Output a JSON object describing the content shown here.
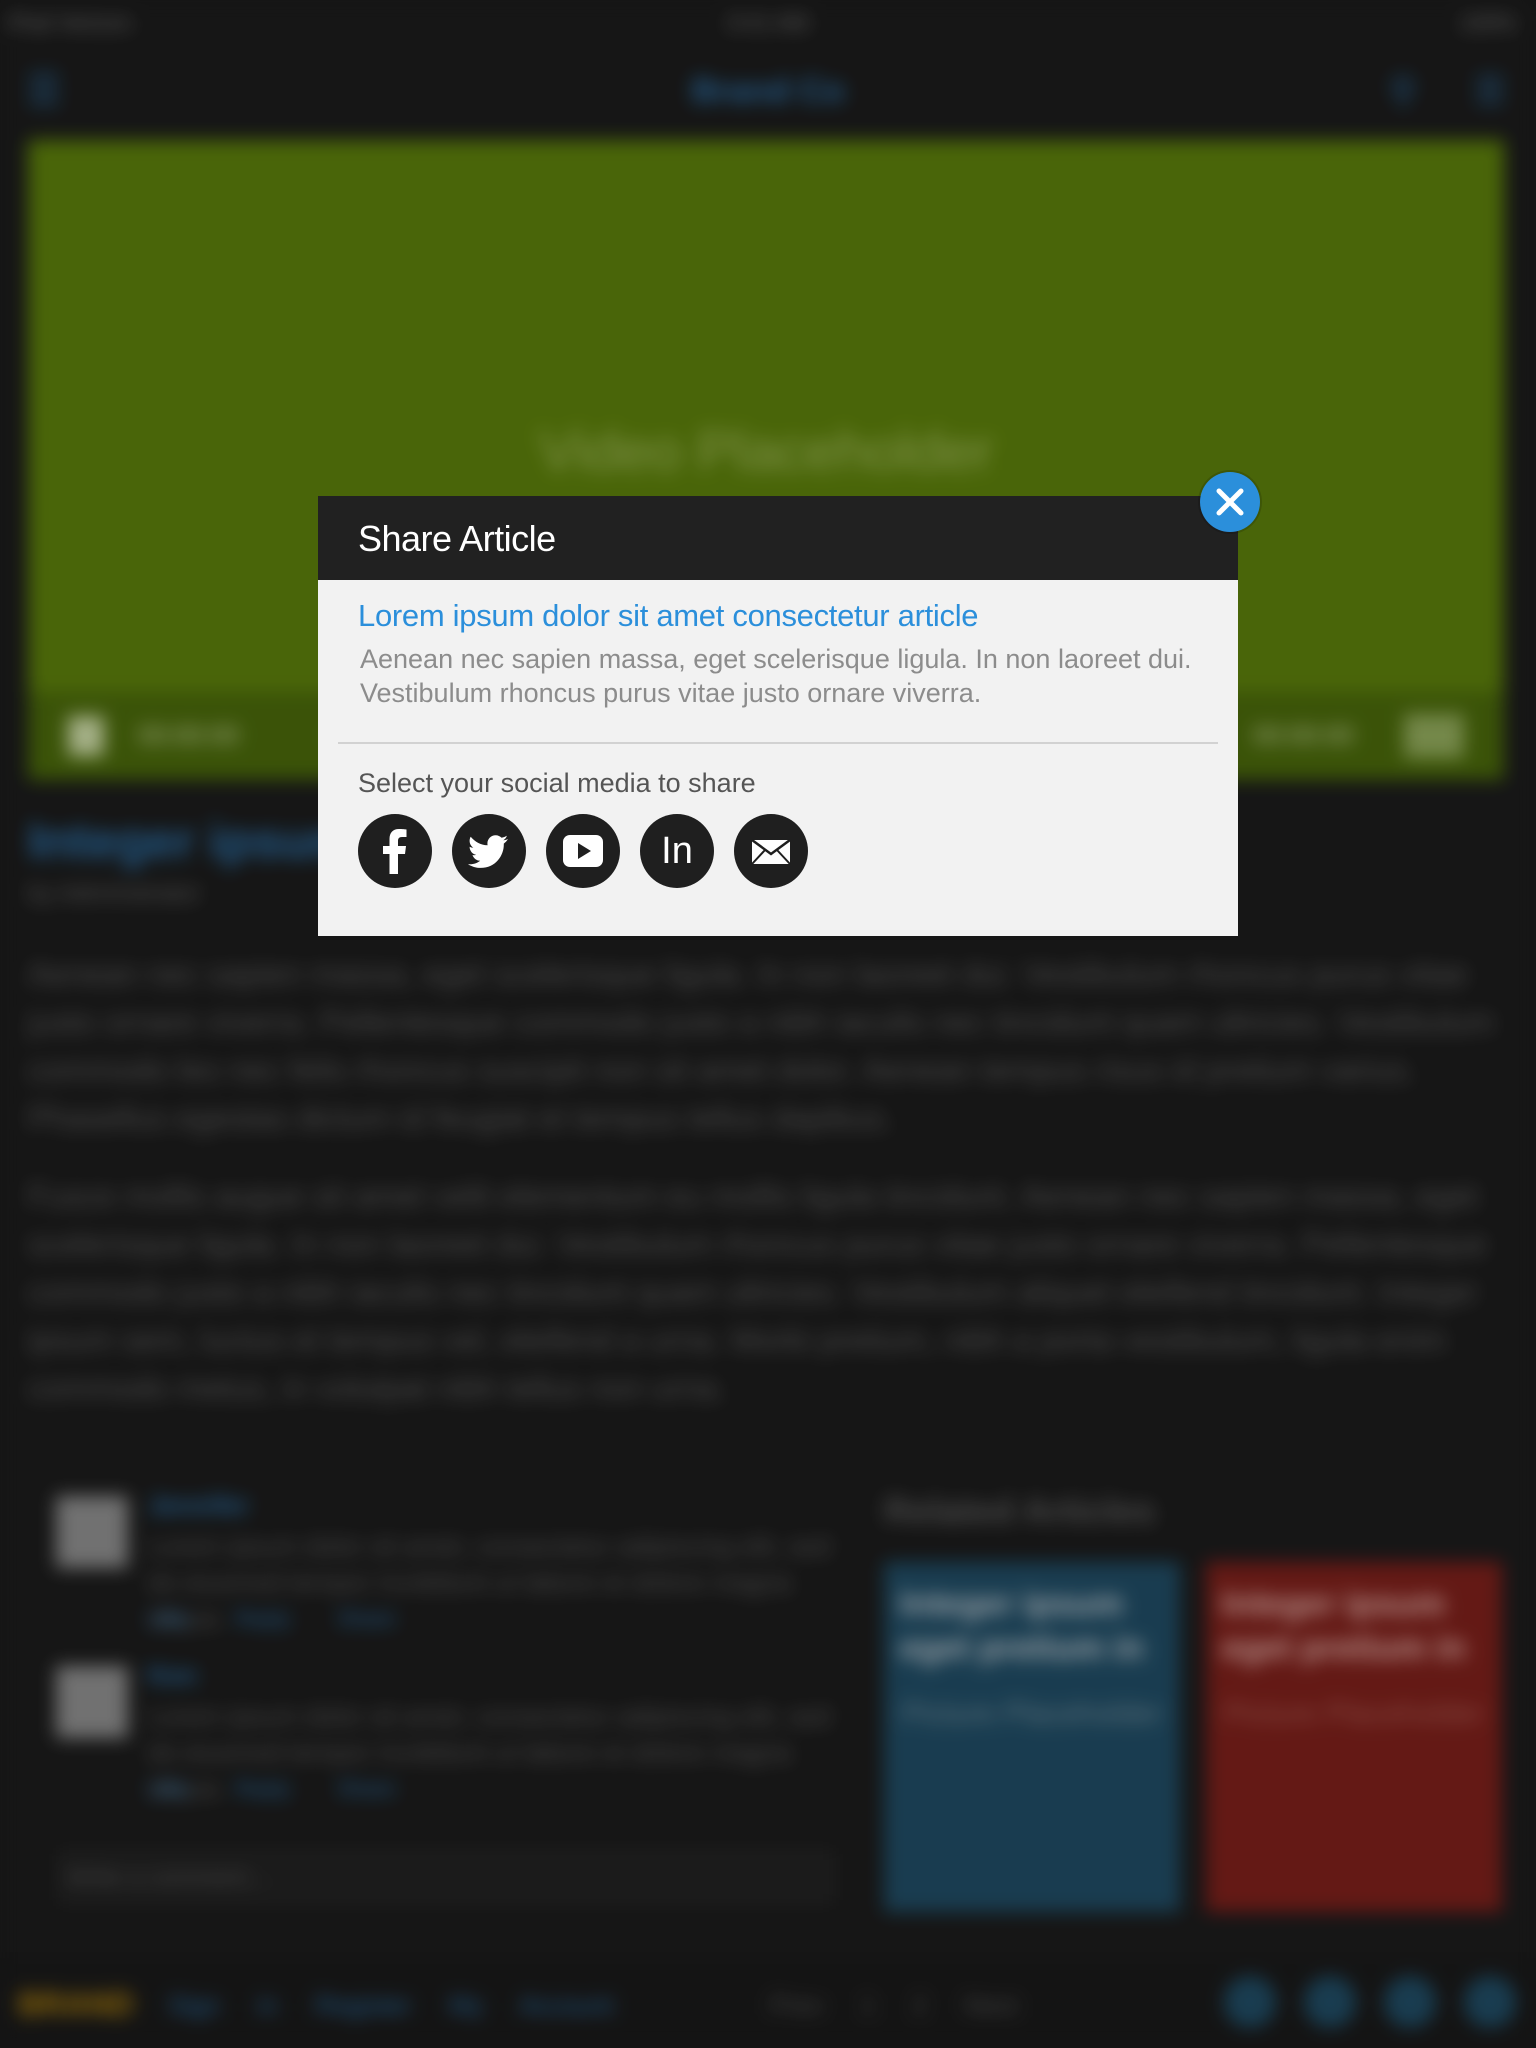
{
  "background": {
    "status_bar": {
      "left": "iPad  Verizon",
      "time": "9:41 AM",
      "right": "100%"
    },
    "nav": {
      "logo": "Brand Co"
    },
    "video": {
      "label": "Video Placeholder",
      "time_elapsed": "00:00:00",
      "time_total": "00:00:00"
    },
    "article": {
      "title": "Integer ipsum",
      "meta": "by Administrator",
      "paragraph1": "Aenean nec sapien massa, eget scelerisque ligula. In non laoreet dui. Vestibulum rhoncus purus vitae justo ornare viverra. Pellentesque commodo justo a nibh iaculis nec tincidunt quam ultricies. Vestibulum commodo leo nec felis rhoncus suscipit non sit amet dolor. Aenean tempus risus id pretium varius. Phasellus egestas dictum id feugiat et tempus tellus dapibus.",
      "paragraph2": "Fusce mollis augue sit amet velit elementum eu mollis ligula tincidunt. Aenean nec sapien massa, eget scelerisque ligula. In non laoreet dui. Vestibulum rhoncus purus vitae justo ornare viverra. Pellentesque commodo justo a nibh iaculis nec tincidunt quam ultricies. Vestibulum aliquet eleifend tincidunt. Integer ipsum sem, luctus et tempus vel, eleifend a urna. Morbi pretium, nibh a porta vestibulum, ligula enim commodo metus, in volutpat nibh tellus non urna."
    },
    "comments": [
      {
        "name": "Jennifer",
        "date": "",
        "text": "Lorem ipsum dolor sit amet, consectetur adipiscing elit, sed do eiusmod tempor incididunt ut labore et dolore magna aliqua.",
        "links": "Like  Reply  Share"
      },
      {
        "name": "Ken",
        "date": "",
        "text": "Lorem ipsum dolor sit amet, consectetur adipiscing elit, sed do eiusmod tempor incididunt ut labore et dolore magna aliqua.",
        "links": "Like  Reply  Share"
      }
    ],
    "comment_placeholder": "Write a comment...",
    "related": {
      "title": "Related Articles",
      "cards": [
        {
          "title": "Integer ipsum eget pretium in",
          "placeholder": "Picture Placeholder"
        },
        {
          "title": "Integer ipsum eget pretium in",
          "placeholder": "Picture Placeholder"
        }
      ]
    },
    "bottom_bar": {
      "logo": "BRAND",
      "links": "Sign in  Register  My Account",
      "mid": "Prev  1  2  Next"
    }
  },
  "modal": {
    "title": "Share Article",
    "article_link": "Lorem ipsum dolor sit amet consectetur article",
    "article_desc": "Aenean nec sapien massa, eget scelerisque ligula. In non laoreet dui. Vestibulum rhoncus purus vitae justo ornare viverra.",
    "select_label": "Select your social media to share",
    "socials": [
      {
        "icon": "facebook-icon"
      },
      {
        "icon": "twitter-icon"
      },
      {
        "icon": "youtube-icon"
      },
      {
        "icon": "linkedin-icon",
        "text": "In"
      },
      {
        "icon": "email-icon"
      }
    ],
    "colors": {
      "header": "#212121",
      "accent": "#2b8fdb",
      "body": "#f2f2f2",
      "icon_circle": "#1f1f1f"
    }
  }
}
